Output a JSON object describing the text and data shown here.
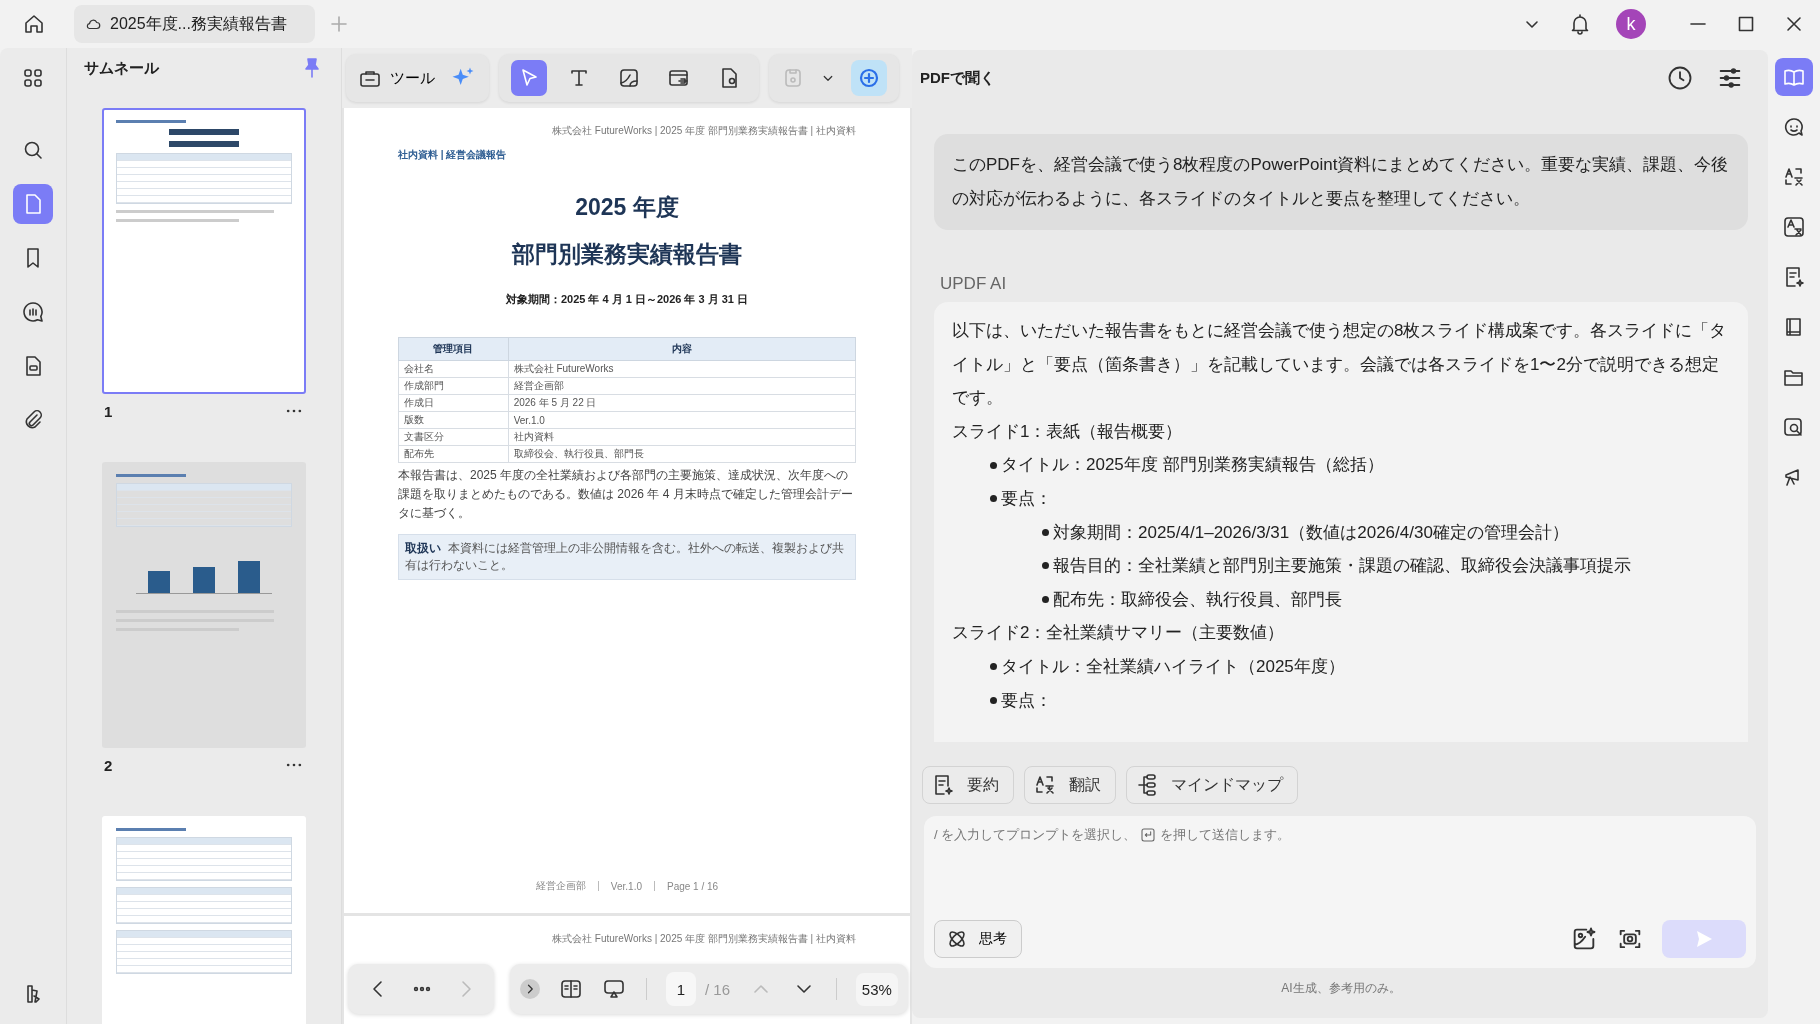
{
  "tab": {
    "title": "2025年度...務実績報告書"
  },
  "avatar": {
    "initial": "k",
    "color": "#a445b8"
  },
  "left_rail": [
    {
      "selected": false
    },
    {
      "selected": false
    },
    {
      "selected": true
    },
    {
      "selected": false
    },
    {
      "selected": false
    },
    {
      "selected": false
    },
    {
      "selected": false
    }
  ],
  "thumbnails": {
    "title": "サムネール",
    "pages": [
      {
        "label": "1",
        "selected": true,
        "dimmed": false
      },
      {
        "label": "2",
        "selected": false,
        "dimmed": true
      },
      {
        "selected": false,
        "dimmed": false
      }
    ]
  },
  "toolbar": {
    "tools_label": "ツール",
    "tools": [
      {
        "selected": true
      },
      {
        "selected": false
      },
      {
        "selected": false
      },
      {
        "selected": false
      },
      {
        "selected": false
      }
    ],
    "save_disabled": true,
    "ai_active": true
  },
  "document": {
    "running_header": "株式会社 FutureWorks | 2025 年度 部門別業務実績報告書 | 社内資料",
    "breadcrumb": "社内資料 | 経営会議報告",
    "title_lines": [
      "2025 年度",
      "部門別業務実績報告書"
    ],
    "period": "対象期間：2025 年 4 月 1 日～2026 年 3 月 31 日",
    "table": {
      "columns": [
        "管理項目",
        "内容"
      ],
      "rows": [
        [
          "会社名",
          "株式会社 FutureWorks"
        ],
        [
          "作成部門",
          "経営企画部"
        ],
        [
          "作成日",
          "2026 年 5 月 22 日"
        ],
        [
          "版数",
          "Ver.1.0"
        ],
        [
          "文書区分",
          "社内資料"
        ],
        [
          "配布先",
          "取締役会、執行役員、部門長"
        ]
      ]
    },
    "paragraph": "本報告書は、2025 年度の全社業績および各部門の主要施策、達成状況、次年度への課題を取りまとめたものである。数値は 2026 年 4 月末時点で確定した管理会計データに基づく。",
    "note": {
      "label": "取扱い",
      "text": "本資料には経営管理上の非公開情報を含む。社外への転送、複製および共有は行わないこと。"
    },
    "footer": [
      "経営企画部",
      "Ver.1.0",
      "Page 1 / 16"
    ],
    "next_page_header": "株式会社 FutureWorks | 2025 年度 部門別業務実績報告書 | 社内資料"
  },
  "viewer_nav": {
    "prev_disabled": false,
    "next_disabled": true,
    "page": "1",
    "total": "/ 16",
    "up_disabled": true,
    "zoom": "53%"
  },
  "ai_panel": {
    "title": "PDFで聞く",
    "user_message": "このPDFを、経営会議で使う8枚程度のPowerPoint資料にまとめてください。重要な実績、課題、今後の対応が伝わるように、各スライドのタイトルと要点を整理してください。",
    "assistant_label": "UPDF AI",
    "answer": {
      "intro": "以下は、いただいた報告書をもとに経営会議で使う想定の8枚スライド構成案です。各スライドに「タイトル」と「要点（箇条書き）」を記載しています。会議では各スライドを1〜2分で説明できる想定です。",
      "slides": [
        {
          "heading": "スライド1：表紙（報告概要）",
          "items": [
            {
              "text": "タイトル：2025年度 部門別業務実績報告（総括）"
            },
            {
              "text": "要点：",
              "children": [
                {
                  "text": "対象期間：2025/4/1–2026/3/31（数値は2026/4/30確定の管理会計）"
                },
                {
                  "text": "報告目的：全社業績と部門別主要施策・課題の確認、取締役会決議事項提示"
                },
                {
                  "text": "配布先：取締役会、執行役員、部門長"
                }
              ]
            }
          ]
        },
        {
          "heading": "スライド2：全社業績サマリー（主要数値）",
          "items": [
            {
              "text": "タイトル：全社業績ハイライト（2025年度）"
            },
            {
              "text": "要点："
            }
          ]
        }
      ]
    },
    "actions": [
      "要約",
      "翻訳",
      "マインドマップ"
    ],
    "prompt_hint": [
      "/ を入力してプロンプトを選択し、",
      "を押して送信します。"
    ],
    "think_label": "思考",
    "send_disabled": true,
    "disclaimer": "AI生成、参考用のみ。",
    "rail": [
      {
        "selected": true
      },
      {
        "selected": false
      },
      {
        "selected": false
      },
      {
        "selected": false
      },
      {
        "selected": false
      },
      {
        "selected": false
      },
      {
        "selected": false
      },
      {
        "selected": false
      },
      {
        "selected": false
      }
    ]
  }
}
